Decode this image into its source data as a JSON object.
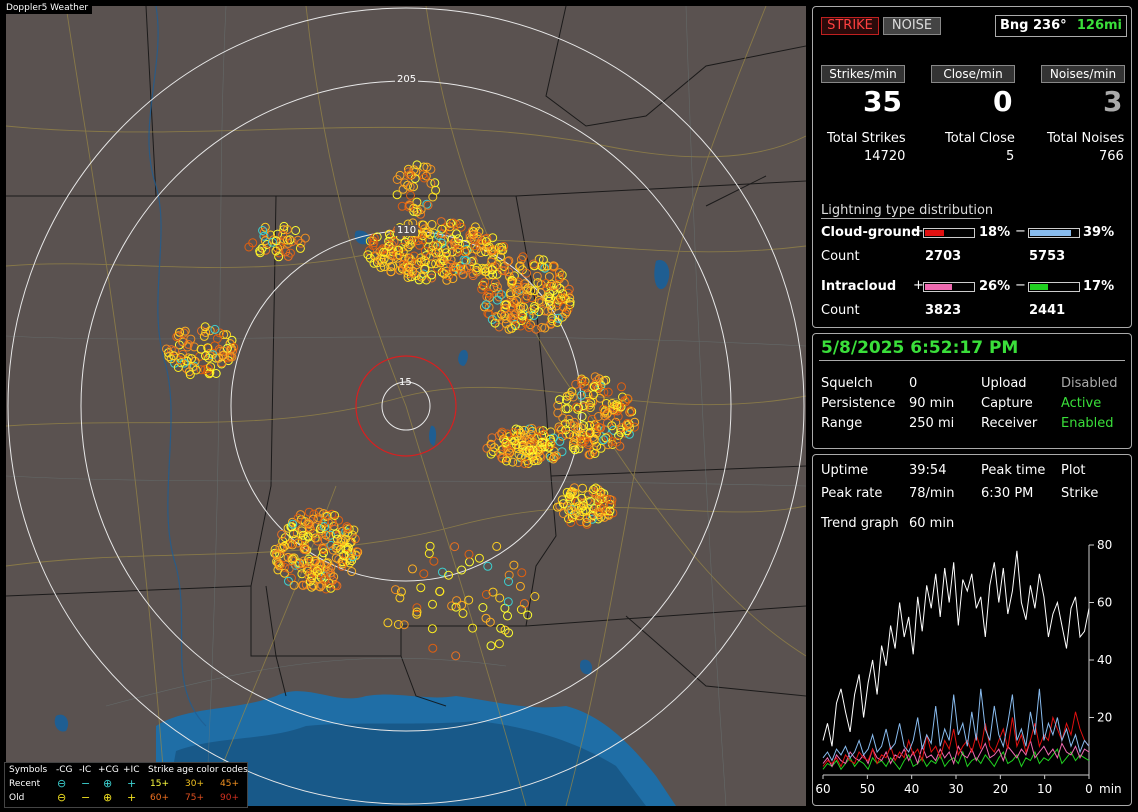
{
  "app": {
    "title": "Doppler5 Weather"
  },
  "map": {
    "ring_labels": [
      "205",
      "110",
      "15"
    ],
    "legend": {
      "symbols_header": "Symbols",
      "neg_cg": "-CG",
      "neg_ic": "-IC",
      "pos_cg": "+CG",
      "pos_ic": "+IC",
      "age_header": "Strike age color codes",
      "recent": "Recent",
      "old": "Old",
      "age_15": "15+",
      "age_30": "30+",
      "age_45": "45+",
      "age_60": "60+",
      "age_75": "75+",
      "age_90": "90+"
    }
  },
  "status": {
    "strike_button": "STRIKE",
    "noise_button": "NOISE",
    "bearing_label": "Bng 236°",
    "distance": "126mi"
  },
  "stats": {
    "strikes_per_min_label": "Strikes/min",
    "strikes_per_min": "35",
    "close_per_min_label": "Close/min",
    "close_per_min": "0",
    "noises_per_min_label": "Noises/min",
    "noises_per_min": "3",
    "total_strikes_label": "Total Strikes",
    "total_strikes": "14720",
    "total_close_label": "Total Close",
    "total_close": "5",
    "total_noises_label": "Total Noises",
    "total_noises": "766"
  },
  "distribution": {
    "title": "Lightning type distribution",
    "cg_label": "Cloud-ground",
    "cg_pos_pct": "18%",
    "cg_neg_pct": "39%",
    "cg_pos_fraction": 0.18,
    "cg_neg_fraction": 0.39,
    "count_label": "Count",
    "cg_pos_count": "2703",
    "cg_neg_count": "5753",
    "ic_label": "Intracloud",
    "ic_pos_pct": "26%",
    "ic_neg_pct": "17%",
    "ic_pos_fraction": 0.26,
    "ic_neg_fraction": 0.17,
    "ic_pos_count": "3823",
    "ic_neg_count": "2441",
    "plus": "+",
    "minus": "−",
    "colors": {
      "cg_pos": "#e01010",
      "cg_neg": "#88bbee",
      "ic_pos": "#ee6ab0",
      "ic_neg": "#20d020"
    }
  },
  "settings": {
    "datetime": "5/8/2025 6:52:17 PM",
    "squelch_label": "Squelch",
    "squelch": "0",
    "persistence_label": "Persistence",
    "persistence": "90 min",
    "range_label": "Range",
    "range": "250 mi",
    "upload_label": "Upload",
    "upload": "Disabled",
    "capture_label": "Capture",
    "capture": "Active",
    "receiver_label": "Receiver",
    "receiver": "Enabled"
  },
  "trend": {
    "uptime_label": "Uptime",
    "uptime": "39:54",
    "peak_time_label": "Peak time",
    "peak_time": "6:30 PM",
    "plot_label": "Plot",
    "plot": "Strike",
    "peak_rate_label": "Peak rate",
    "peak_rate": "78/min",
    "trend_graph_label": "Trend graph",
    "trend_graph": "60 min"
  },
  "chart_data": {
    "type": "line",
    "x_tick_labels": [
      "60",
      "50",
      "40",
      "30",
      "20",
      "10",
      "0"
    ],
    "x_unit": "min",
    "y_tick_labels": [
      "80",
      "60",
      "40",
      "20"
    ],
    "ylim": [
      0,
      80
    ],
    "xlim": [
      60,
      0
    ],
    "series": [
      {
        "color": "#ffffff",
        "values": [
          12,
          18,
          10,
          25,
          30,
          22,
          15,
          28,
          35,
          20,
          32,
          40,
          28,
          45,
          38,
          52,
          44,
          60,
          48,
          55,
          42,
          62,
          50,
          66,
          58,
          70,
          55,
          72,
          60,
          74,
          52,
          68,
          64,
          70,
          58,
          62,
          48,
          66,
          74,
          60,
          72,
          56,
          64,
          78,
          60,
          54,
          66,
          58,
          70,
          62,
          48,
          56,
          60,
          52,
          44,
          58,
          62,
          48,
          50,
          58
        ]
      },
      {
        "color": "#88bbee",
        "values": [
          6,
          8,
          5,
          9,
          7,
          10,
          6,
          8,
          12,
          7,
          9,
          14,
          8,
          10,
          16,
          9,
          11,
          18,
          10,
          8,
          12,
          20,
          9,
          14,
          11,
          24,
          10,
          16,
          12,
          28,
          14,
          18,
          10,
          22,
          12,
          30,
          16,
          12,
          24,
          14,
          10,
          18,
          28,
          12,
          16,
          10,
          22,
          14,
          30,
          12,
          18,
          14,
          20,
          12,
          16,
          10,
          14,
          8,
          12,
          10
        ]
      },
      {
        "color": "#e01010",
        "values": [
          3,
          5,
          4,
          6,
          3,
          7,
          5,
          4,
          8,
          6,
          5,
          9,
          4,
          7,
          6,
          10,
          5,
          8,
          6,
          12,
          7,
          9,
          5,
          14,
          8,
          10,
          6,
          12,
          9,
          16,
          7,
          10,
          12,
          8,
          14,
          9,
          18,
          10,
          8,
          12,
          16,
          9,
          20,
          10,
          14,
          8,
          12,
          18,
          10,
          14,
          12,
          20,
          16,
          12,
          18,
          14,
          22,
          16,
          12,
          10
        ]
      },
      {
        "color": "#ee6ab0",
        "values": [
          4,
          6,
          3,
          7,
          5,
          4,
          8,
          6,
          5,
          7,
          4,
          9,
          6,
          5,
          8,
          4,
          7,
          6,
          9,
          5,
          8,
          4,
          10,
          6,
          7,
          5,
          9,
          6,
          8,
          4,
          10,
          7,
          6,
          9,
          5,
          8,
          11,
          6,
          7,
          9,
          5,
          10,
          8,
          6,
          9,
          7,
          12,
          6,
          8,
          10,
          7,
          9,
          6,
          11,
          8,
          7,
          10,
          6,
          9,
          8
        ]
      },
      {
        "color": "#20d020",
        "values": [
          2,
          4,
          3,
          5,
          2,
          4,
          6,
          3,
          5,
          4,
          2,
          6,
          4,
          5,
          3,
          6,
          4,
          2,
          5,
          7,
          3,
          4,
          6,
          3,
          5,
          4,
          7,
          3,
          5,
          6,
          4,
          8,
          3,
          5,
          6,
          4,
          7,
          5,
          3,
          6,
          8,
          4,
          5,
          7,
          3,
          6,
          5,
          8,
          4,
          6,
          5,
          7,
          9,
          4,
          6,
          8,
          5,
          7,
          6,
          5
        ]
      }
    ]
  }
}
